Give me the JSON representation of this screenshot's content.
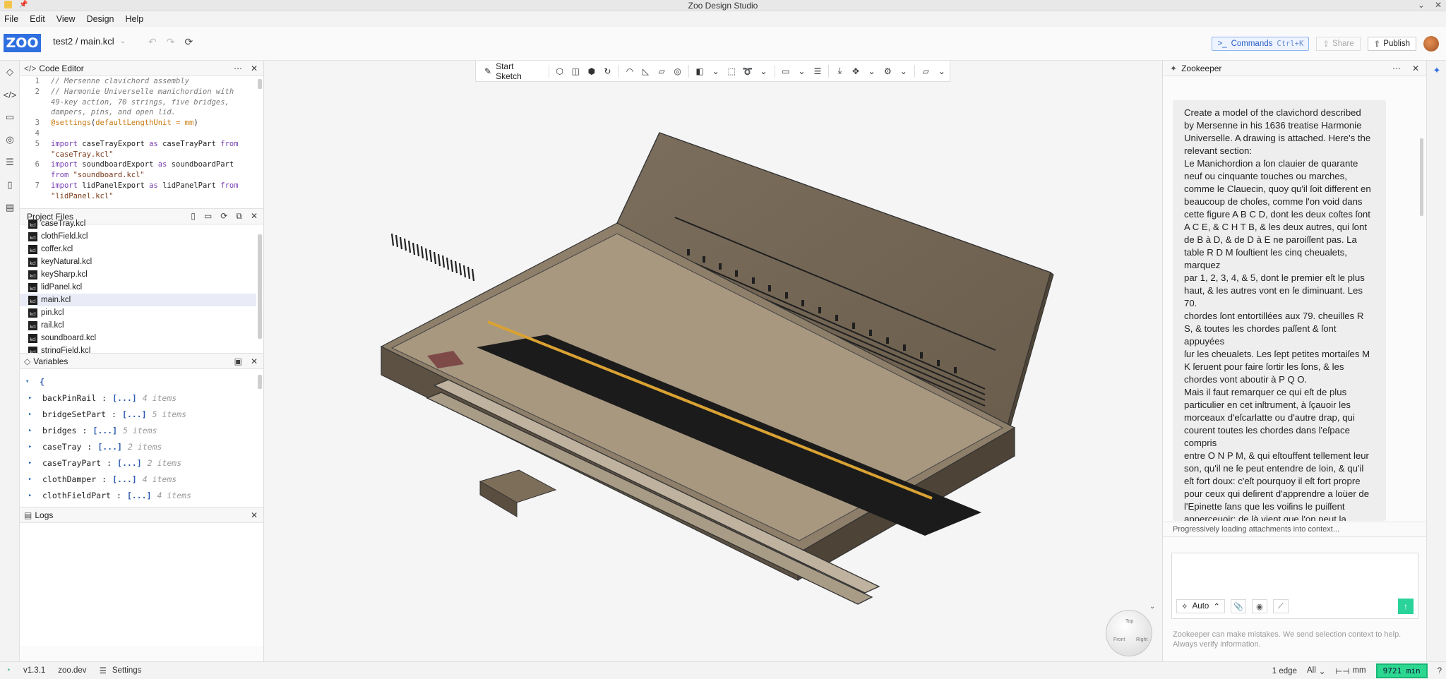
{
  "window": {
    "title": "Zoo Design Studio",
    "controls": [
      "⌄",
      "✕"
    ]
  },
  "menu": [
    "File",
    "Edit",
    "View",
    "Design",
    "Help"
  ],
  "toolbar": {
    "logo": "ZOO",
    "file_path": "test2 / main.kcl",
    "commands_label": "Commands",
    "commands_shortcut": "Ctrl+K",
    "share_label": "Share",
    "publish_label": "Publish"
  },
  "code_editor": {
    "title": "Code Editor",
    "lines": [
      {
        "n": "1",
        "parts": [
          {
            "c": "cm",
            "t": "// Mersenne clavichord assembly"
          }
        ]
      },
      {
        "n": "2",
        "parts": [
          {
            "c": "cm",
            "t": "// Harmonie Universelle manichordion with"
          }
        ]
      },
      {
        "n": "",
        "parts": [
          {
            "c": "cm",
            "t": "49-key action, 70 strings, five bridges,"
          }
        ]
      },
      {
        "n": "",
        "parts": [
          {
            "c": "cm",
            "t": "dampers, pins, and open lid."
          }
        ]
      },
      {
        "n": "3",
        "parts": [
          {
            "c": "fn",
            "t": "@settings"
          },
          {
            "c": "id",
            "t": "("
          },
          {
            "c": "fn",
            "t": "defaultLengthUnit = mm"
          },
          {
            "c": "id",
            "t": ")"
          }
        ]
      },
      {
        "n": "4",
        "parts": [
          {
            "c": "id",
            "t": ""
          }
        ]
      },
      {
        "n": "5",
        "parts": [
          {
            "c": "kw",
            "t": "import "
          },
          {
            "c": "id",
            "t": "caseTrayExport "
          },
          {
            "c": "kw",
            "t": "as "
          },
          {
            "c": "id",
            "t": "caseTrayPart "
          },
          {
            "c": "kw",
            "t": "from"
          }
        ]
      },
      {
        "n": "",
        "parts": [
          {
            "c": "st",
            "t": "\"caseTray.kcl\""
          }
        ]
      },
      {
        "n": "6",
        "parts": [
          {
            "c": "kw",
            "t": "import "
          },
          {
            "c": "id",
            "t": "soundboardExport "
          },
          {
            "c": "kw",
            "t": "as "
          },
          {
            "c": "id",
            "t": "soundboardPart"
          }
        ]
      },
      {
        "n": "",
        "parts": [
          {
            "c": "kw",
            "t": "from "
          },
          {
            "c": "st",
            "t": "\"soundboard.kcl\""
          }
        ]
      },
      {
        "n": "7",
        "parts": [
          {
            "c": "kw",
            "t": "import "
          },
          {
            "c": "id",
            "t": "lidPanelExport "
          },
          {
            "c": "kw",
            "t": "as "
          },
          {
            "c": "id",
            "t": "lidPanelPart "
          },
          {
            "c": "kw",
            "t": "from"
          }
        ]
      },
      {
        "n": "",
        "parts": [
          {
            "c": "st",
            "t": "\"lidPanel.kcl\""
          }
        ]
      }
    ]
  },
  "project_files": {
    "title": "Project Files",
    "files": [
      "caseTray.kcl",
      "clothField.kcl",
      "coffer.kcl",
      "keyNatural.kcl",
      "keySharp.kcl",
      "lidPanel.kcl",
      "main.kcl",
      "pin.kcl",
      "rail.kcl",
      "soundboard.kcl",
      "stringField.kcl"
    ],
    "selected": "main.kcl",
    "icon_label": "kcl"
  },
  "variables": {
    "title": "Variables",
    "open_brace": "{",
    "items": [
      {
        "name": "backPinRail",
        "value": "[...]",
        "count": "4 items"
      },
      {
        "name": "bridgeSetPart",
        "value": "[...]",
        "count": "5 items"
      },
      {
        "name": "bridges",
        "value": "[...]",
        "count": "5 items"
      },
      {
        "name": "caseTray",
        "value": "[...]",
        "count": "2 items"
      },
      {
        "name": "caseTrayPart",
        "value": "[...]",
        "count": "2 items"
      },
      {
        "name": "clothDamper",
        "value": "[...]",
        "count": "4 items"
      },
      {
        "name": "clothFieldPart",
        "value": "[...]",
        "count": "4 items"
      }
    ]
  },
  "logs": {
    "title": "Logs"
  },
  "viewport": {
    "start_sketch_label": "Start Sketch",
    "navcube_labels": [
      "Top",
      "Front",
      "Right"
    ]
  },
  "zookeeper": {
    "title": "Zookeeper",
    "message_lines": [
      "Create a model of the clavichord described",
      "by Mersenne in his 1636 treatise Harmonie",
      "Universelle. A drawing is attached. Here's the",
      "relevant section:",
      "Le Manichordion a ſon clauier de quarante",
      "neuf ou cinquante touches ou marches,",
      "comme le Clauecin, quoy qu'il ſoit different en",
      "beaucoup de choſes, comme l'on void dans",
      "cette figure A B C D, dont les deux coſtes ſont",
      "A C E, & C H T B, & les deux autres, qui ſont",
      "de B à D, & de D à E ne paroiſſent pas. La",
      "table R D M ſouſtient les cinq cheualets,",
      "marquez",
      "par 1, 2, 3, 4, & 5, dont le premier eſt le plus",
      "haut, & les autres vont en ſe diminuant. Les",
      "70.",
      "chordes ſont entortillées aux 79. cheuilles R",
      "S, & toutes les chordes paſſent & ſont",
      "appuyées",
      "ſur les cheualets. Les ſept petites mortaiſes M",
      "K ſeruent pour faire ſortir les ſons, & les",
      "chordes vont aboutir à P Q O.",
      "Mais il faut remarquer ce qui eſt de plus",
      "particulier en cet inſtrument, à ſçauoir les",
      "morceaux d'eſcarlatte ou d'autre drap, qui",
      "courent toutes les chordes dans l'eſpace",
      "compris",
      "entre O N P M, & qui eſtouffent tellement leur",
      "son, qu'il ne ſe peut entendre de loin, & qu'il",
      "eſt fort doux: c'eſt pourquoy il eſt fort propre",
      "pour ceux qui deſirent d'apprendre a loüer de",
      "l'Epinette ſans que les voiſins le puiſſent",
      "apperceuoir; de là vient que l'on peut la"
    ],
    "loading_note": "Progressively loading attachments into context...",
    "mode_label": "Auto",
    "disclaimer": "Zookeeper can make mistakes. We send selection context to help. Always verify information."
  },
  "status": {
    "version": "v1.3.1",
    "site": "zoo.dev",
    "settings_label": "Settings",
    "selection": "1 edge",
    "filter": "All",
    "units": "mm",
    "minutes": "9721 min",
    "help": "?"
  },
  "colors": {
    "accent": "#2f6fe0",
    "send": "#29d39a",
    "minutes_bg": "#2cd790",
    "model_wood": "#6e6150"
  }
}
